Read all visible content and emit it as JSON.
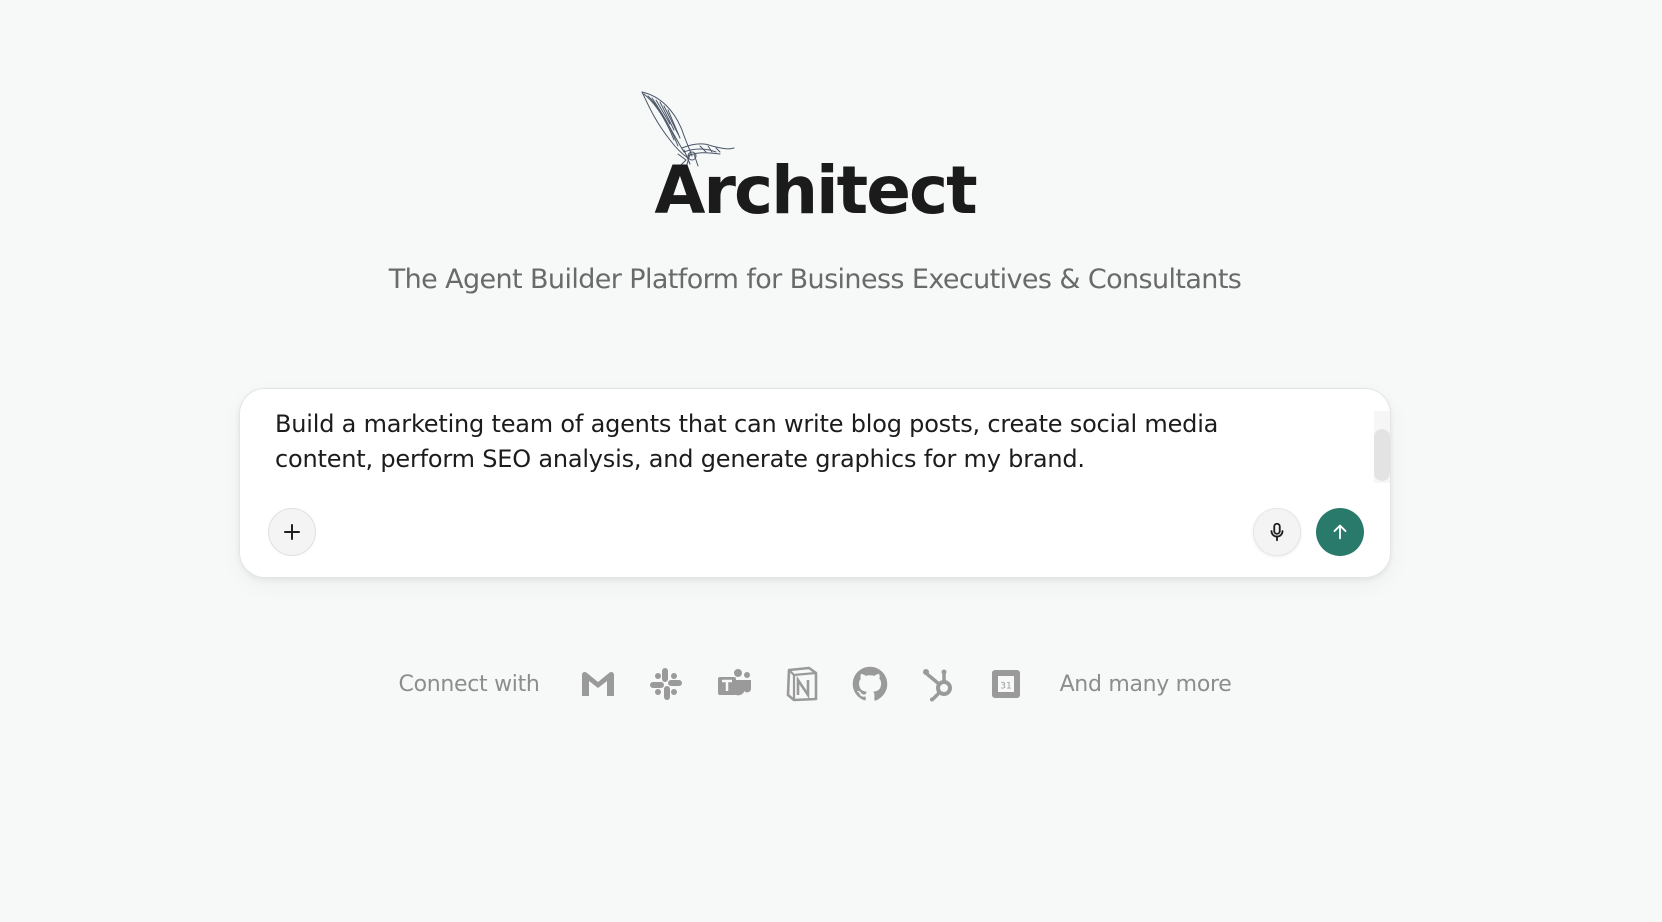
{
  "app": {
    "title": "Architect",
    "tagline": "The Agent Builder Platform for Business Executives & Consultants"
  },
  "composer": {
    "value": "Build a marketing team of agents that can write blog posts, create social media content, perform SEO analysis, and generate graphics for my brand.",
    "add_icon": "plus-icon",
    "mic_icon": "microphone-icon",
    "send_icon": "arrow-up-icon",
    "send_color": "#2a7a6c"
  },
  "integrations": {
    "label": "Connect with",
    "items": [
      {
        "name": "gmail",
        "icon": "gmail-icon"
      },
      {
        "name": "slack",
        "icon": "slack-icon"
      },
      {
        "name": "teams",
        "icon": "microsoft-teams-icon"
      },
      {
        "name": "notion",
        "icon": "notion-icon"
      },
      {
        "name": "github",
        "icon": "github-icon"
      },
      {
        "name": "hubspot",
        "icon": "hubspot-icon"
      },
      {
        "name": "calendar",
        "icon": "calendar-icon"
      }
    ],
    "more_label": "And many more",
    "icon_color": "#9a9a9a"
  }
}
